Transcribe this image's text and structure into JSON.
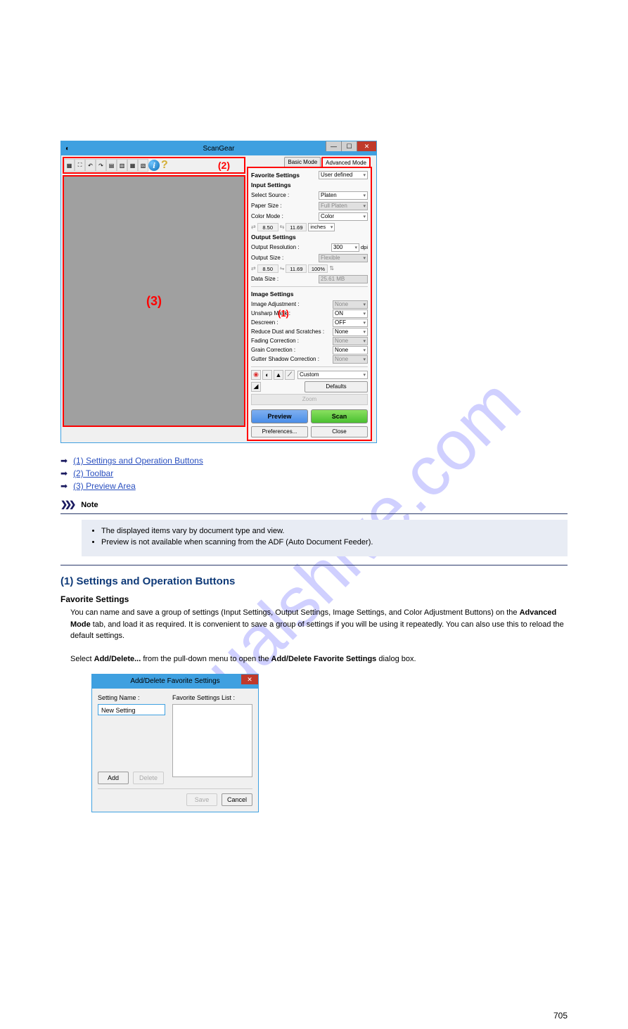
{
  "watermark": "manualshive.com",
  "sg": {
    "title": "ScanGear",
    "tabs": {
      "basic": "Basic Mode",
      "advanced": "Advanced Mode"
    },
    "annot": {
      "one": "(1)",
      "two": "(2)",
      "three": "(3)"
    },
    "favorite": {
      "label": "Favorite Settings",
      "value": "User defined"
    },
    "input": {
      "header": "Input Settings",
      "source": {
        "label": "Select Source :",
        "value": "Platen"
      },
      "paper": {
        "label": "Paper Size :",
        "value": "Full Platen"
      },
      "color": {
        "label": "Color Mode :",
        "value": "Color"
      },
      "dim": {
        "w": "8.50",
        "h": "11.69",
        "units": "inches"
      }
    },
    "output": {
      "header": "Output Settings",
      "res": {
        "label": "Output Resolution :",
        "value": "300",
        "unit": "dpi"
      },
      "size": {
        "label": "Output Size :",
        "value": "Flexible"
      },
      "dim": {
        "w": "8.50",
        "h": "11.69",
        "pct": "100%"
      },
      "data": {
        "label": "Data Size :",
        "value": "25.61 MB"
      }
    },
    "image": {
      "header": "Image Settings",
      "adj": {
        "label": "Image Adjustment :",
        "value": "None"
      },
      "unsharp": {
        "label": "Unsharp Mask :",
        "value": "ON"
      },
      "descreen": {
        "label": "Descreen :",
        "value": "OFF"
      },
      "dust": {
        "label": "Reduce Dust and Scratches :",
        "value": "None"
      },
      "fading": {
        "label": "Fading Correction :",
        "value": "None"
      },
      "grain": {
        "label": "Grain Correction :",
        "value": "None"
      },
      "gutter": {
        "label": "Gutter Shadow Correction :",
        "value": "None"
      }
    },
    "custom": "Custom",
    "defaults": "Defaults",
    "zoom": "Zoom",
    "preview": "Preview",
    "scan": "Scan",
    "prefs": "Preferences...",
    "close": "Close"
  },
  "doc": {
    "links": {
      "one": "(1) Settings and Operation Buttons",
      "two": "(2) Toolbar",
      "three": "(3) Preview Area"
    },
    "note_label": "Note",
    "notes": {
      "a": "The displayed items vary by document type and view.",
      "b": "Preview is not available when scanning from the ADF (Auto Document Feeder)."
    },
    "sec_title": "(1) Settings and Operation Buttons",
    "fav_label": "Favorite Settings",
    "fav_p1": "You can name and save a group of settings (Input Settings, Output Settings, Image Settings, and Color Adjustment Buttons) on the ",
    "fav_bold": "Advanced Mode",
    "fav_p2": " tab, and load it as required. It is convenient to save a group of settings if you will be using it repeatedly. You can also use this to reload the default settings.",
    "fav_p3": "Select ",
    "fav_bold2": "Add/Delete...",
    "fav_p4": " from the pull-down menu to open the ",
    "fav_bold3": "Add/Delete Favorite Settings",
    "fav_p5": " dialog box."
  },
  "addel": {
    "title": "Add/Delete Favorite Settings",
    "name_label": "Setting Name :",
    "name_value": "New Setting",
    "list_label": "Favorite Settings List :",
    "add": "Add",
    "delete": "Delete",
    "save": "Save",
    "cancel": "Cancel"
  },
  "page": "705"
}
